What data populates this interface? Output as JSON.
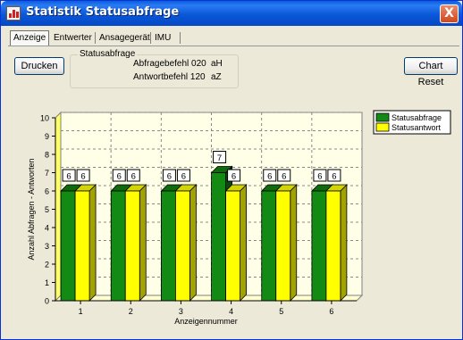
{
  "window": {
    "title": "Statistik Statusabfrage",
    "close_glyph": "X"
  },
  "tabs": [
    {
      "label": "Anzeige",
      "active": true
    },
    {
      "label": "Entwerter",
      "active": false
    },
    {
      "label": "Ansagegerät",
      "active": false
    },
    {
      "label": "IMU",
      "active": false
    }
  ],
  "toolbar": {
    "print_label": "Drucken",
    "reset_label": "Chart Reset"
  },
  "status_group": {
    "title": "Statusabfrage",
    "rows": [
      {
        "label": "Abfragebefehl 020",
        "value": "aH"
      },
      {
        "label": "Antwortbefehl 120",
        "value": "aZ"
      }
    ]
  },
  "colors": {
    "series_a": "#138a13",
    "series_b": "#ffff00",
    "backwall": "#ffffe8",
    "titlebar": "#0a58d8"
  },
  "chart_data": {
    "type": "bar",
    "categories": [
      "1",
      "2",
      "3",
      "4",
      "5",
      "6"
    ],
    "series": [
      {
        "name": "Statusabfrage",
        "values": [
          6,
          6,
          6,
          7,
          6,
          6
        ]
      },
      {
        "name": "Statusantwort",
        "values": [
          6,
          6,
          6,
          6,
          6,
          6
        ]
      }
    ],
    "xlabel": "Anzeigennummer",
    "ylabel": "Anzahl Abfragen - Antworten",
    "ylim": [
      0,
      10
    ],
    "yticks": [
      0,
      1,
      2,
      3,
      4,
      5,
      6,
      7,
      8,
      9,
      10
    ],
    "grid": true,
    "legend": "top-right",
    "style": "3d"
  }
}
